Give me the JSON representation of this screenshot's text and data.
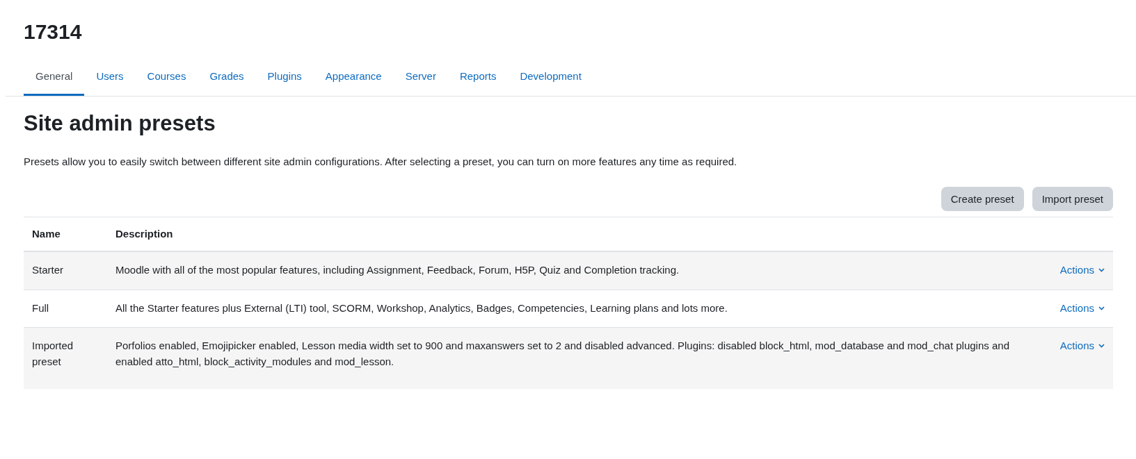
{
  "site_title": "17314",
  "tabs": [
    {
      "label": "General",
      "selected": true
    },
    {
      "label": "Users",
      "selected": false
    },
    {
      "label": "Courses",
      "selected": false
    },
    {
      "label": "Grades",
      "selected": false
    },
    {
      "label": "Plugins",
      "selected": false
    },
    {
      "label": "Appearance",
      "selected": false
    },
    {
      "label": "Server",
      "selected": false
    },
    {
      "label": "Reports",
      "selected": false
    },
    {
      "label": "Development",
      "selected": false
    }
  ],
  "page_heading": "Site admin presets",
  "intro": "Presets allow you to easily switch between different site admin configurations. After selecting a preset, you can turn on more features any time as required.",
  "buttons": [
    "Create preset",
    "Import preset"
  ],
  "table": {
    "columns": [
      "Name",
      "Description"
    ],
    "rows": [
      {
        "name": "Starter",
        "description": "Moodle with all of the most popular features, including Assignment, Feedback, Forum, H5P, Quiz and Completion tracking.",
        "action": "Actions"
      },
      {
        "name": "Full",
        "description": "All the Starter features plus External (LTI) tool, SCORM, Workshop, Analytics, Badges, Competencies, Learning plans and lots more.",
        "action": "Actions"
      },
      {
        "name": "Imported preset",
        "description": "Porfolios enabled, Emojipicker enabled, Lesson media width set to 900 and maxanswers set to 2 and disabled advanced. Plugins: disabled block_html, mod_database and mod_chat plugins and enabled atto_html, block_activity_modules and mod_lesson.",
        "action": "Actions"
      }
    ]
  }
}
